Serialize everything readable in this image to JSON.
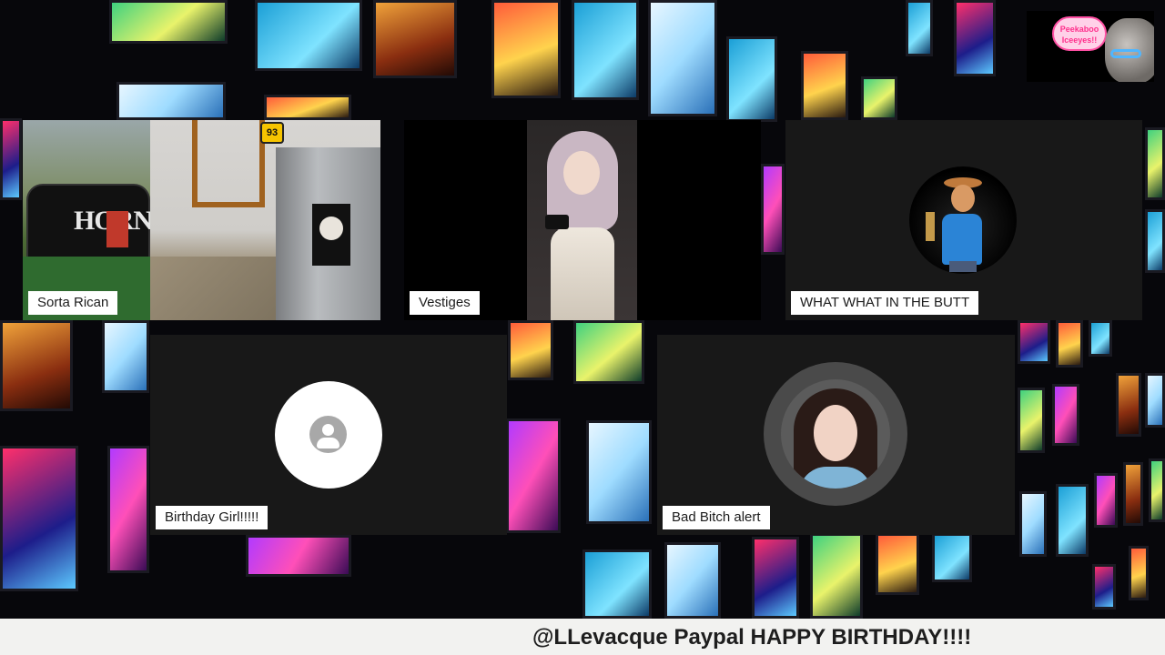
{
  "participants": [
    {
      "name": "Sorta Rican"
    },
    {
      "name": "Vestiges"
    },
    {
      "name": "WHAT WHAT IN THE BUTT"
    },
    {
      "name": "Birthday Girl!!!!!"
    },
    {
      "name": "Bad Bitch alert"
    }
  ],
  "badge_number": "93",
  "stream_logo": {
    "text": "Peekaboo Iceeyes!!"
  },
  "ticker": {
    "text": "@LLevacque Paypal HAPPY BIRTHDAY!!!!"
  },
  "colors": {
    "card_bg": "#181818",
    "tag_bg": "#ffffff",
    "ticker_bg": "#f2f2f0"
  },
  "icons": [
    "person-icon",
    "stream-logo"
  ]
}
